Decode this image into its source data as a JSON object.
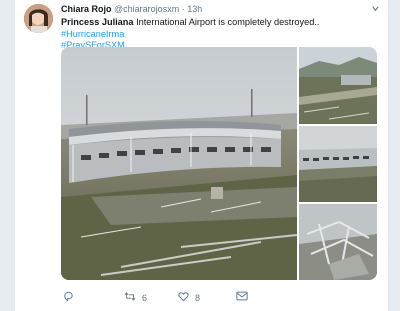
{
  "tweet": {
    "display_name": "Chiara Rojo",
    "handle": "@chiararojosxm",
    "separator": "·",
    "time": "13h",
    "text_bold": "Princess Juliana",
    "text_plain": " International Airport is completely destroyed..",
    "hashtag1": "#HurricaneIrma",
    "hashtag2": "#PraySForSXM",
    "media": [
      {
        "subject": "damaged airport terminal"
      },
      {
        "subject": "aerial damage overview"
      },
      {
        "subject": "terminal building"
      },
      {
        "subject": "collapsed structure"
      }
    ]
  },
  "actions": {
    "retweets": "6",
    "likes": "8"
  },
  "icons": [
    "avatar",
    "chevron-down-icon",
    "reply-icon",
    "retweet-icon",
    "like-icon",
    "message-icon"
  ],
  "colors": {
    "link": "#1da1f2",
    "text": "#14171a",
    "muted": "#657786"
  }
}
